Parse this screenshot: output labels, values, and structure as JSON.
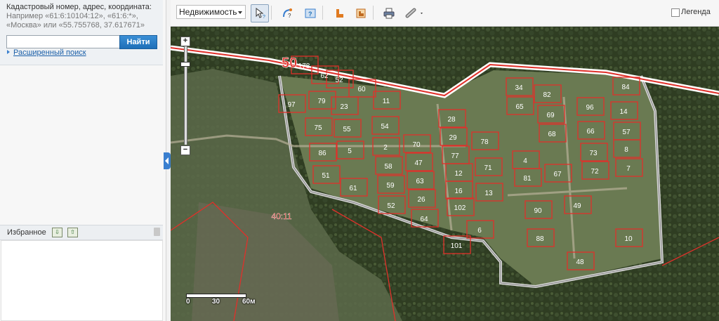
{
  "search": {
    "hint": "Кадастровый номер, адрес, координата:",
    "example": "Например «61:6:10104:12», «61:6:*», «Москва» или «55.755768, 37.617671»",
    "input_value": "",
    "button": "Найти",
    "advanced": "Расширенный поиск"
  },
  "favorites": {
    "title": "Избранное"
  },
  "toolbar": {
    "layer_select": "Недвижимость",
    "legend_label": "Легенда",
    "legend_checked": false,
    "tools": [
      "select-tool-icon",
      "measure-tool-icon",
      "info-tool-icon",
      "building-tool-icon",
      "parcel-tool-icon",
      "print-icon",
      "link-icon"
    ]
  },
  "map": {
    "road_label": "50",
    "district_label": "40:11",
    "scale": {
      "zero": "0",
      "mid": "30",
      "end": "60м"
    },
    "plots": [
      {
        "n": "178"
      },
      {
        "n": "62"
      },
      {
        "n": "52"
      },
      {
        "n": "60"
      },
      {
        "n": "97"
      },
      {
        "n": "79"
      },
      {
        "n": "23"
      },
      {
        "n": "11"
      },
      {
        "n": "75"
      },
      {
        "n": "55"
      },
      {
        "n": "54"
      },
      {
        "n": "86"
      },
      {
        "n": "5"
      },
      {
        "n": "2"
      },
      {
        "n": "70"
      },
      {
        "n": "51"
      },
      {
        "n": "58"
      },
      {
        "n": "47"
      },
      {
        "n": "61"
      },
      {
        "n": "59"
      },
      {
        "n": "63"
      },
      {
        "n": "52"
      },
      {
        "n": "26"
      },
      {
        "n": "64"
      },
      {
        "n": "28"
      },
      {
        "n": "29"
      },
      {
        "n": "77"
      },
      {
        "n": "78"
      },
      {
        "n": "12"
      },
      {
        "n": "71"
      },
      {
        "n": "16"
      },
      {
        "n": "13"
      },
      {
        "n": "102"
      },
      {
        "n": "6"
      },
      {
        "n": "101"
      },
      {
        "n": "34"
      },
      {
        "n": "65"
      },
      {
        "n": "82"
      },
      {
        "n": "69"
      },
      {
        "n": "68"
      },
      {
        "n": "4"
      },
      {
        "n": "81"
      },
      {
        "n": "67"
      },
      {
        "n": "84"
      },
      {
        "n": "96"
      },
      {
        "n": "14"
      },
      {
        "n": "66"
      },
      {
        "n": "57"
      },
      {
        "n": "73"
      },
      {
        "n": "8"
      },
      {
        "n": "72"
      },
      {
        "n": "7"
      },
      {
        "n": "90"
      },
      {
        "n": "49"
      },
      {
        "n": "88"
      },
      {
        "n": "48"
      },
      {
        "n": "10"
      }
    ]
  },
  "colors": {
    "boundary": "#e0302a",
    "settlement": "#d8d8d8",
    "accent": "#1e6fb8"
  }
}
